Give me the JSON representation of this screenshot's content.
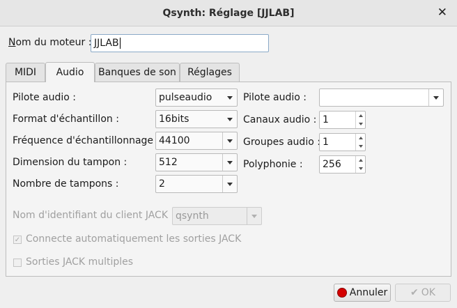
{
  "window": {
    "title": "Qsynth: Réglage [JJLAB]",
    "close_glyph": "✕"
  },
  "engine": {
    "label": "Nom du moteur :",
    "value": "JJLAB"
  },
  "tabs": [
    {
      "label": "MIDI"
    },
    {
      "label": "Audio",
      "active": true
    },
    {
      "label": "Banques de son"
    },
    {
      "label": "Réglages"
    }
  ],
  "audio": {
    "left": [
      {
        "label": "Pilote audio :",
        "value": "pulseaudio"
      },
      {
        "label": "Format d'échantillon :",
        "value": "16bits"
      },
      {
        "label": "Fréquence d'échantillonnage :",
        "value": "44100"
      },
      {
        "label": "Dimension du tampon :",
        "value": "512"
      },
      {
        "label": "Nombre de tampons :",
        "value": "2"
      }
    ],
    "right": [
      {
        "label": "Pilote audio :",
        "value": ""
      },
      {
        "label": "Canaux audio :",
        "value": "1"
      },
      {
        "label": "Groupes audio :",
        "value": "1"
      },
      {
        "label": "Polyphonie :",
        "value": "256"
      }
    ],
    "jack_client_label": "Nom d'identifiant du client JACK :",
    "jack_client_value": "qsynth",
    "jack_autoconnect": {
      "label": "Connecte automatiquement les sorties JACK",
      "checked": true
    },
    "jack_multi": {
      "label": "Sorties JACK multiples",
      "checked": false
    }
  },
  "buttons": {
    "cancel": "Annuler",
    "ok": "OK"
  },
  "colors": {
    "cancel_icon": "#d40000",
    "focus_border": "#8aa9c7"
  }
}
